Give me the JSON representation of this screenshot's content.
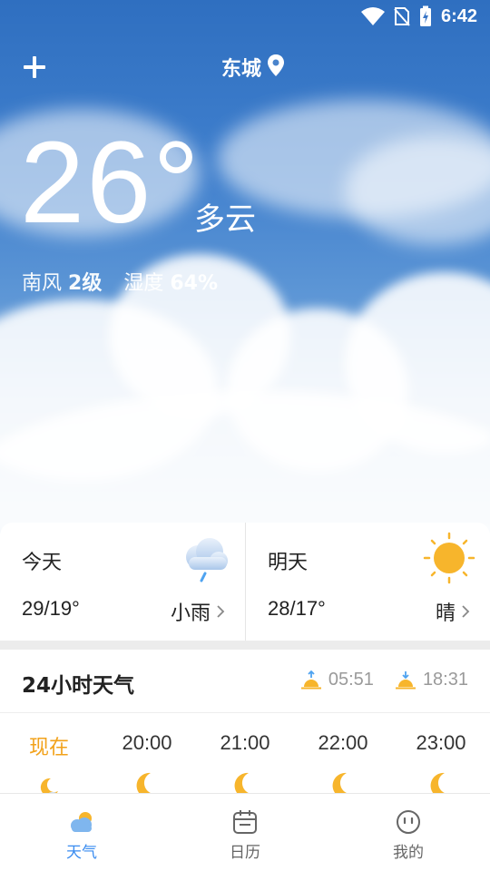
{
  "status_bar": {
    "time": "6:42"
  },
  "header": {
    "city": "东城"
  },
  "current": {
    "temperature": "26°",
    "condition": "多云",
    "wind_label": "南风",
    "wind_value": "2级",
    "humidity_label": "湿度",
    "humidity_value": "64%"
  },
  "forecast": {
    "today": {
      "name": "今天",
      "range": "29/19°",
      "condition": "小雨",
      "icon": "rain-cloud-icon"
    },
    "tomorrow": {
      "name": "明天",
      "range": "28/17°",
      "condition": "晴",
      "icon": "sun-icon"
    }
  },
  "hourly": {
    "title": "24小时天气",
    "sunrise": "05:51",
    "sunset": "18:31",
    "hours": [
      {
        "label": "现在",
        "icon": "partly-cloudy-night-icon"
      },
      {
        "label": "20:00",
        "icon": "moon-icon"
      },
      {
        "label": "21:00",
        "icon": "moon-icon"
      },
      {
        "label": "22:00",
        "icon": "moon-icon"
      },
      {
        "label": "23:00",
        "icon": "moon-icon"
      }
    ]
  },
  "tabs": [
    {
      "label": "天气",
      "icon": "weather-icon",
      "active": true
    },
    {
      "label": "日历",
      "icon": "calendar-icon",
      "active": false
    },
    {
      "label": "我的",
      "icon": "profile-icon",
      "active": false
    }
  ],
  "colors": {
    "accent_tab": "#3a8cf0",
    "now_label": "#f2a21b",
    "sun": "#f7b52c"
  }
}
